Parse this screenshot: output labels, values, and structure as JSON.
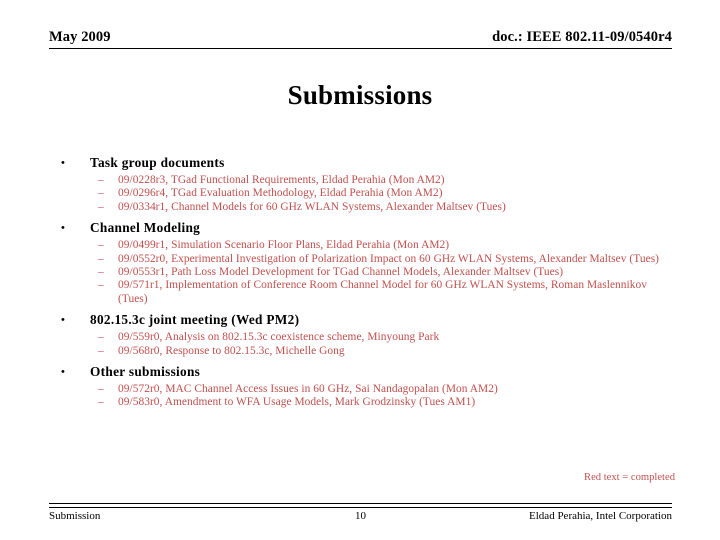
{
  "header": {
    "left": "May 2009",
    "right": "doc.: IEEE 802.11-09/0540r4"
  },
  "title": "Submissions",
  "colors": {
    "completed_red": "#C0504D",
    "text_black": "#000000"
  },
  "bullet_glyphs": {
    "level1": "•",
    "level2": "–"
  },
  "sections": [
    {
      "heading": "Task group documents",
      "items": [
        "09/0228r3, TGad Functional Requirements, Eldad Perahia (Mon AM2)",
        "09/0296r4, TGad Evaluation Methodology, Eldad Perahia (Mon AM2)",
        "09/0334r1, Channel Models for 60 GHz WLAN Systems, Alexander Maltsev (Tues)"
      ]
    },
    {
      "heading": "Channel Modeling",
      "items": [
        "09/0499r1, Simulation Scenario Floor Plans, Eldad Perahia (Mon AM2)",
        "09/0552r0, Experimental Investigation of Polarization Impact on 60 GHz WLAN Systems, Alexander Maltsev (Tues)",
        "09/0553r1, Path Loss Model Development for TGad Channel Models, Alexander Maltsev (Tues)",
        "09/571r1, Implementation of Conference Room Channel Model for 60 GHz WLAN Systems, Roman Maslennikov (Tues)"
      ]
    },
    {
      "heading": "802.15.3c joint meeting (Wed PM2)",
      "items": [
        "09/559r0, Analysis on 802.15.3c coexistence scheme, Minyoung Park",
        "09/568r0, Response to 802.15.3c, Michelle Gong"
      ]
    },
    {
      "heading": "Other submissions",
      "items": [
        "09/572r0, MAC Channel Access Issues in 60 GHz, Sai Nandagopalan (Mon AM2)",
        "09/583r0, Amendment to WFA Usage Models, Mark Grodzinsky (Tues AM1)"
      ]
    }
  ],
  "note": "Red text = completed",
  "footer": {
    "left": "Submission",
    "center": "10",
    "right": "Eldad Perahia, Intel Corporation"
  }
}
